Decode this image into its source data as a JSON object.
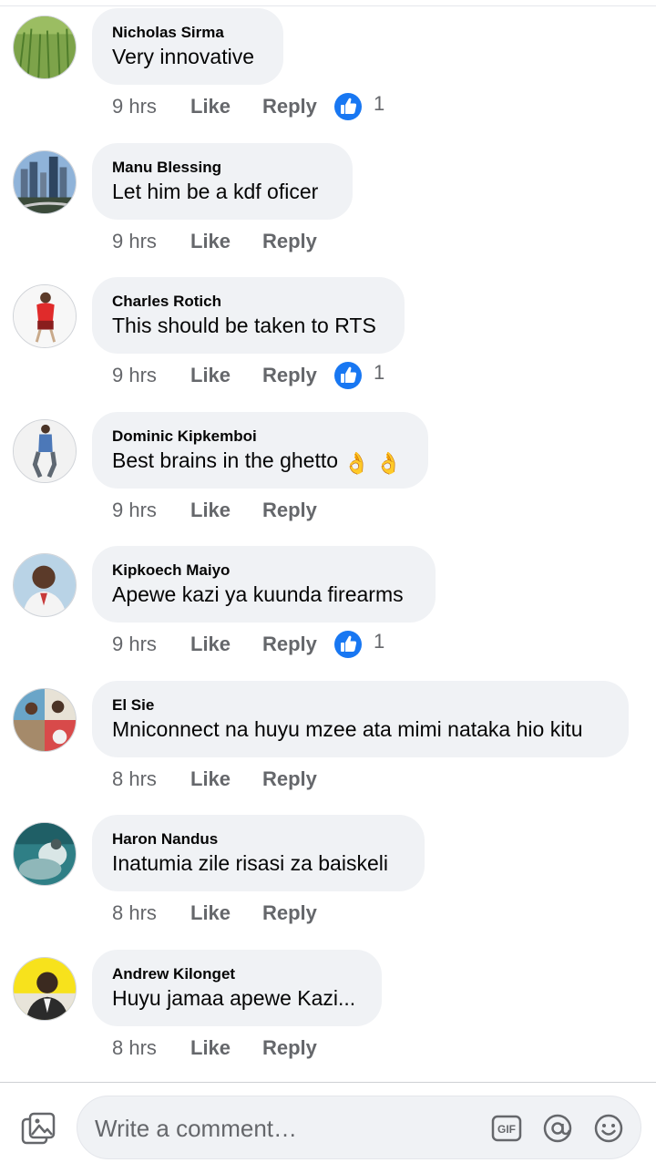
{
  "comments": [
    {
      "author": "Nicholas Sirma",
      "text": "Very innovative",
      "time": "9 hrs",
      "like": "Like",
      "reply": "Reply",
      "reactions": "1",
      "avatar": "field-photo"
    },
    {
      "author": "Manu Blessing",
      "text": "Let him be a kdf oficer",
      "time": "9 hrs",
      "like": "Like",
      "reply": "Reply",
      "reactions": "",
      "avatar": "city-photo"
    },
    {
      "author": "Charles Rotich",
      "text": "This should be taken to RTS",
      "time": "9 hrs",
      "like": "Like",
      "reply": "Reply",
      "reactions": "1",
      "avatar": "man-red-shirt-photo"
    },
    {
      "author": "Dominic Kipkemboi",
      "text": "Best brains in the ghetto",
      "emoji": "👌 👌",
      "time": "9 hrs",
      "like": "Like",
      "reply": "Reply",
      "reactions": "",
      "avatar": "standing-man-photo"
    },
    {
      "author": "Kipkoech Maiyo",
      "text": "Apewe kazi ya kuunda firearms",
      "time": "9 hrs",
      "like": "Like",
      "reply": "Reply",
      "reactions": "1",
      "avatar": "man-portrait-photo"
    },
    {
      "author": "El Sie",
      "text": "Mniconnect na huyu mzee ata mimi nataka hio kitu",
      "time": "8 hrs",
      "like": "Like",
      "reply": "Reply",
      "reactions": "",
      "avatar": "group-photo"
    },
    {
      "author": "Haron Nandus",
      "text": "Inatumia zile risasi za baiskeli",
      "time": "8 hrs",
      "like": "Like",
      "reply": "Reply",
      "reactions": "",
      "avatar": "teal-photo"
    },
    {
      "author": "Andrew Kilonget",
      "text": "Huyu jamaa apewe Kazi...",
      "time": "8 hrs",
      "like": "Like",
      "reply": "Reply",
      "reactions": "",
      "avatar": "yellow-bg-photo"
    }
  ],
  "composer": {
    "placeholder": "Write a comment…",
    "photo_icon": "photo-icon",
    "gif_icon": "gif-icon",
    "mention_icon": "at-icon",
    "emoji_icon": "emoji-icon"
  },
  "colors": {
    "accent": "#1877f2",
    "bubble": "#f0f2f5",
    "secondary_text": "#65676b"
  }
}
